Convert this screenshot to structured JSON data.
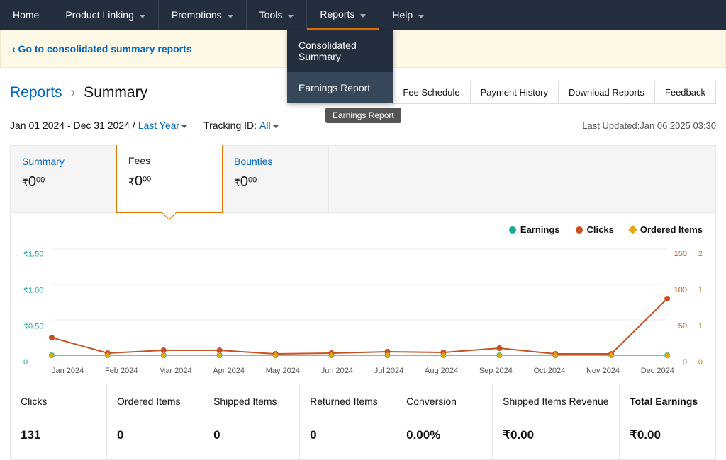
{
  "nav": {
    "home": "Home",
    "product_linking": "Product Linking",
    "promotions": "Promotions",
    "tools": "Tools",
    "reports": "Reports",
    "help": "Help"
  },
  "dropdown": {
    "consolidated_l1": "Consolidated",
    "consolidated_l2": "Summary",
    "earnings": "Earnings Report"
  },
  "tooltip": "Earnings Report",
  "banner": {
    "text": "‹ Go to consolidated summary reports"
  },
  "breadcrumb": {
    "parent": "Reports",
    "current": "Summary"
  },
  "header_links": {
    "fee_schedule": "Fee Schedule",
    "payment_history": "Payment History",
    "download_reports": "Download Reports",
    "feedback": "Feedback"
  },
  "filters": {
    "date_range": "Jan 01 2024 - Dec 31 2024 /",
    "preset": "Last Year",
    "tracking_label": "Tracking ID:",
    "tracking_value": "All",
    "last_updated_label": "Last Updated:",
    "last_updated_value": "Jan 06 2025 03:30"
  },
  "tabs": {
    "summary": {
      "label": "Summary",
      "currency": "₹",
      "whole": "0",
      "cents": "00"
    },
    "fees": {
      "label": "Fees",
      "currency": "₹",
      "whole": "0",
      "cents": "00"
    },
    "bounties": {
      "label": "Bounties",
      "currency": "₹",
      "whole": "0",
      "cents": "00"
    }
  },
  "legend": {
    "earnings": "Earnings",
    "clicks": "Clicks",
    "ordered_items": "Ordered Items"
  },
  "colors": {
    "earnings": "#1aa99d",
    "clicks": "#c7511f",
    "ordered_items": "#e3a80c"
  },
  "chart_data": {
    "type": "line",
    "categories": [
      "Jan 2024",
      "Feb 2024",
      "Mar 2024",
      "Apr 2024",
      "May 2024",
      "Jun 2024",
      "Jul 2024",
      "Aug 2024",
      "Sep 2024",
      "Oct 2024",
      "Nov 2024",
      "Dec 2024"
    ],
    "series": [
      {
        "name": "Earnings",
        "values": [
          0,
          0,
          0,
          0,
          0,
          0,
          0,
          0,
          0,
          0,
          0,
          0
        ],
        "axis": "left",
        "color": "#1aa99d"
      },
      {
        "name": "Clicks",
        "values": [
          25,
          3,
          7,
          7,
          2,
          3,
          5,
          4,
          10,
          2,
          2,
          80
        ],
        "axis": "right1",
        "color": "#c7511f"
      },
      {
        "name": "Ordered Items",
        "values": [
          0,
          0,
          0,
          0,
          0,
          0,
          0,
          0,
          0,
          0,
          0,
          0
        ],
        "axis": "right2",
        "color": "#e3a80c"
      }
    ],
    "y_left": {
      "ticks": [
        "0",
        "₹0.50",
        "₹1.00",
        "₹1.50"
      ],
      "range": [
        0,
        1.5
      ]
    },
    "y_right1": {
      "ticks": [
        "0",
        "50",
        "100",
        "150"
      ],
      "range": [
        0,
        150
      ]
    },
    "y_right2": {
      "ticks": [
        "0",
        "1",
        "1",
        "2"
      ],
      "range": [
        0,
        2
      ]
    }
  },
  "stats": {
    "clicks": {
      "label": "Clicks",
      "value": "131"
    },
    "ordered_items": {
      "label": "Ordered Items",
      "value": "0"
    },
    "shipped_items": {
      "label": "Shipped Items",
      "value": "0"
    },
    "returned_items": {
      "label": "Returned Items",
      "value": "0"
    },
    "conversion": {
      "label": "Conversion",
      "value": "0.00%"
    },
    "shipped_revenue": {
      "label": "Shipped Items Revenue",
      "value": "₹0.00"
    },
    "total_earnings": {
      "label": "Total Earnings",
      "value": "₹0.00"
    }
  }
}
